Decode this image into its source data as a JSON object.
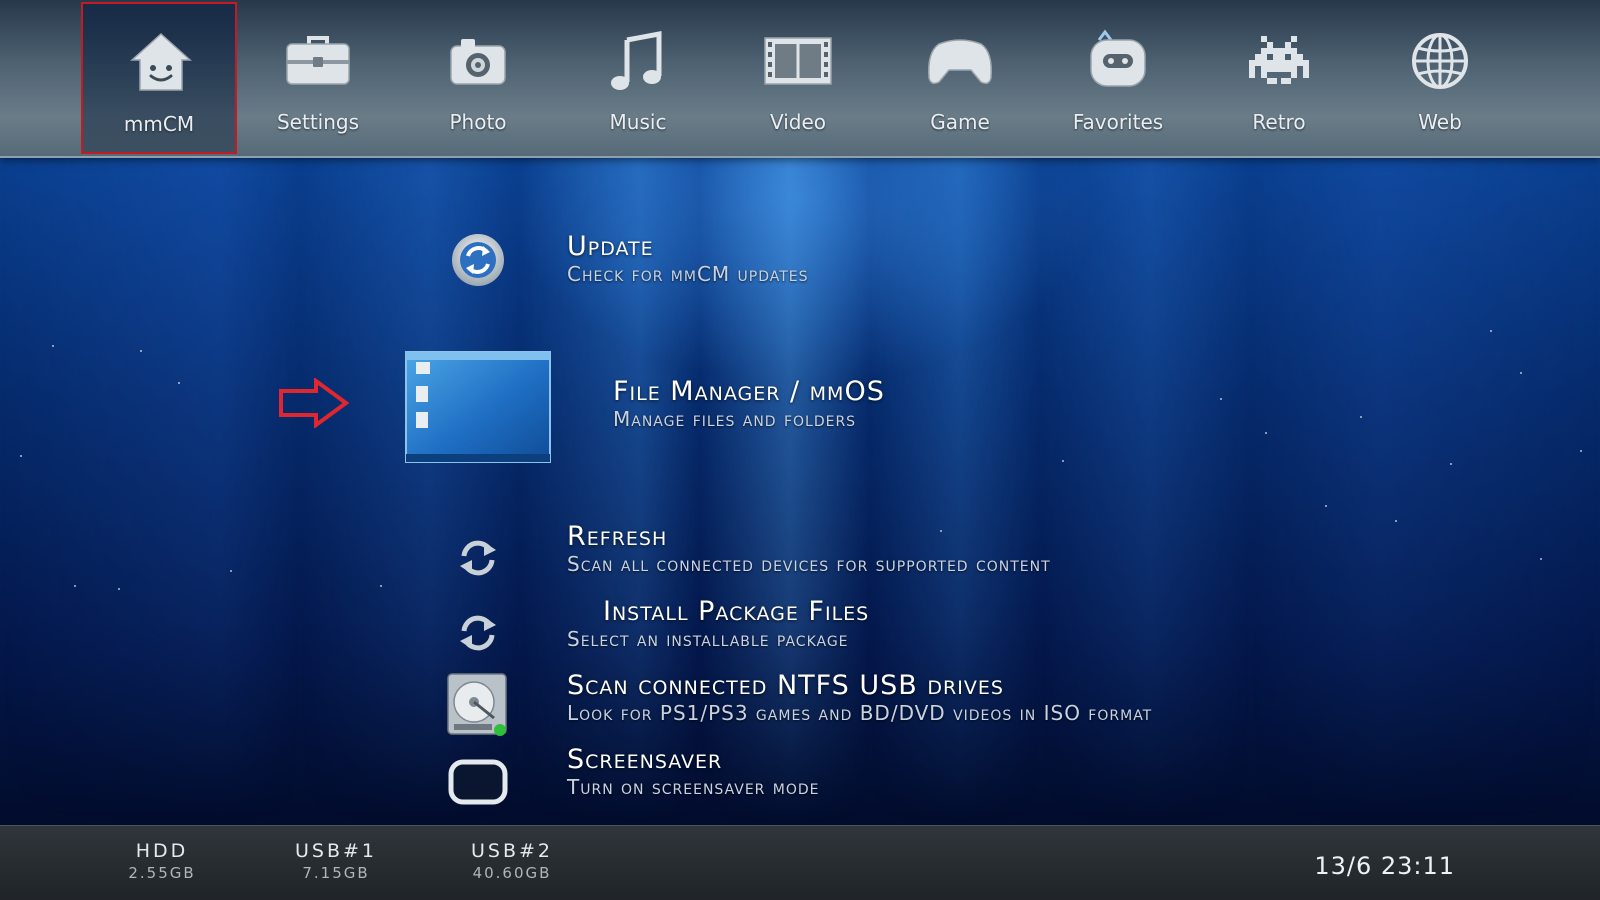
{
  "nav": {
    "items": [
      {
        "label": "mmCM",
        "icon": "home-face-icon",
        "selected": true
      },
      {
        "label": "Settings",
        "icon": "toolbox-icon",
        "selected": false
      },
      {
        "label": "Photo",
        "icon": "camera-icon",
        "selected": false
      },
      {
        "label": "Music",
        "icon": "music-note-icon",
        "selected": false
      },
      {
        "label": "Video",
        "icon": "film-strip-icon",
        "selected": false
      },
      {
        "label": "Game",
        "icon": "gamepad-icon",
        "selected": false
      },
      {
        "label": "Favorites",
        "icon": "robot-head-icon",
        "selected": false
      },
      {
        "label": "Retro",
        "icon": "space-invader-icon",
        "selected": false
      },
      {
        "label": "Web",
        "icon": "globe-icon",
        "selected": false
      }
    ]
  },
  "menu": {
    "items": [
      {
        "title": "Update",
        "subtitle": "Check for mmCM updates",
        "icon": "update-circle-icon"
      },
      {
        "title": "File Manager / mmOS",
        "subtitle": "Manage files and folders",
        "icon": "file-manager-window-icon",
        "focused": true
      },
      {
        "title": "Refresh",
        "subtitle": "Scan all connected devices for supported content",
        "icon": "refresh-arrows-icon"
      },
      {
        "title": "Install Package Files",
        "subtitle": "Select an installable package",
        "icon": "refresh-arrows-icon"
      },
      {
        "title": "Scan connected NTFS USB drives",
        "subtitle": "Look for PS1/PS3 games and BD/DVD videos in ISO format",
        "icon": "hard-drive-icon"
      },
      {
        "title": "Screensaver",
        "subtitle": "Turn on screensaver mode",
        "icon": "screen-outline-icon"
      }
    ]
  },
  "status": {
    "drives": [
      {
        "name": "HDD",
        "size": "2.55GB"
      },
      {
        "name": "USB#1",
        "size": "7.15GB"
      },
      {
        "name": "USB#2",
        "size": "40.60GB"
      }
    ],
    "clock": "13/6 23:11"
  },
  "colors": {
    "selection_border": "#c41a22",
    "arrow_marker": "#e0262e"
  }
}
